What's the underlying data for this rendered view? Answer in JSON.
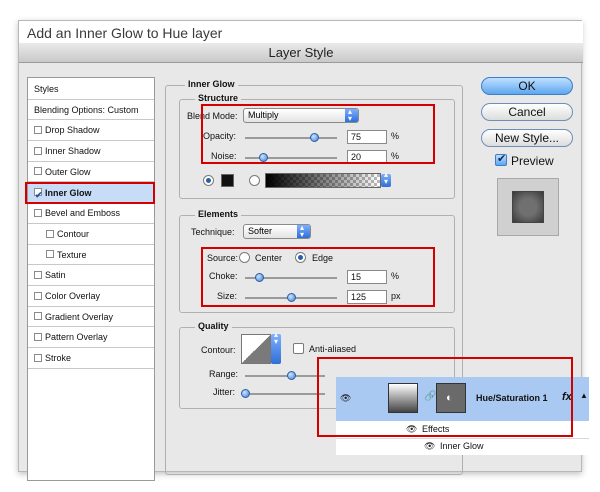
{
  "caption": "Add an Inner Glow to Hue layer",
  "dialog_title": "Layer Style",
  "styles_list": [
    {
      "label": "Styles",
      "checkbox": false,
      "checked": false,
      "active": false,
      "indent": false
    },
    {
      "label": "Blending Options: Custom",
      "checkbox": false,
      "checked": false,
      "active": false,
      "indent": false
    },
    {
      "label": "Drop Shadow",
      "checkbox": true,
      "checked": false,
      "active": false,
      "indent": false
    },
    {
      "label": "Inner Shadow",
      "checkbox": true,
      "checked": false,
      "active": false,
      "indent": false
    },
    {
      "label": "Outer Glow",
      "checkbox": true,
      "checked": false,
      "active": false,
      "indent": false
    },
    {
      "label": "Inner Glow",
      "checkbox": true,
      "checked": true,
      "active": true,
      "indent": false
    },
    {
      "label": "Bevel and Emboss",
      "checkbox": true,
      "checked": false,
      "active": false,
      "indent": false
    },
    {
      "label": "Contour",
      "checkbox": true,
      "checked": false,
      "active": false,
      "indent": true
    },
    {
      "label": "Texture",
      "checkbox": true,
      "checked": false,
      "active": false,
      "indent": true
    },
    {
      "label": "Satin",
      "checkbox": true,
      "checked": false,
      "active": false,
      "indent": false
    },
    {
      "label": "Color Overlay",
      "checkbox": true,
      "checked": false,
      "active": false,
      "indent": false
    },
    {
      "label": "Gradient Overlay",
      "checkbox": true,
      "checked": false,
      "active": false,
      "indent": false
    },
    {
      "label": "Pattern Overlay",
      "checkbox": true,
      "checked": false,
      "active": false,
      "indent": false
    },
    {
      "label": "Stroke",
      "checkbox": true,
      "checked": false,
      "active": false,
      "indent": false
    }
  ],
  "inner_glow": {
    "title": "Inner Glow",
    "structure": {
      "title": "Structure",
      "blend_mode_label": "Blend Mode:",
      "blend_mode_value": "Multiply",
      "opacity_label": "Opacity:",
      "opacity_value": "75",
      "opacity_unit": "%",
      "opacity_level": 0.75,
      "noise_label": "Noise:",
      "noise_value": "20",
      "noise_unit": "%",
      "noise_level": 0.2,
      "color_swatch": "#111111"
    },
    "elements": {
      "title": "Elements",
      "technique_label": "Technique:",
      "technique_value": "Softer",
      "source_label": "Source:",
      "source_center": "Center",
      "source_edge": "Edge",
      "choke_label": "Choke:",
      "choke_value": "15",
      "choke_unit": "%",
      "choke_level": 0.15,
      "size_label": "Size:",
      "size_value": "125",
      "size_unit": "px",
      "size_level": 0.5
    },
    "quality": {
      "title": "Quality",
      "contour_label": "Contour:",
      "anti_aliased_label": "Anti-aliased",
      "range_label": "Range:",
      "jitter_label": "Jitter:"
    }
  },
  "buttons": {
    "ok": "OK",
    "cancel": "Cancel",
    "new_style": "New Style...",
    "preview": "Preview"
  },
  "layers_panel": {
    "layer_name": "Hue/Saturation 1",
    "fx": "fx",
    "effects": "Effects",
    "inner_glow": "Inner Glow"
  },
  "colors": {
    "highlight": "#d40000",
    "selection": "#c7dcf7",
    "layer_selected": "#a9c9f2"
  }
}
